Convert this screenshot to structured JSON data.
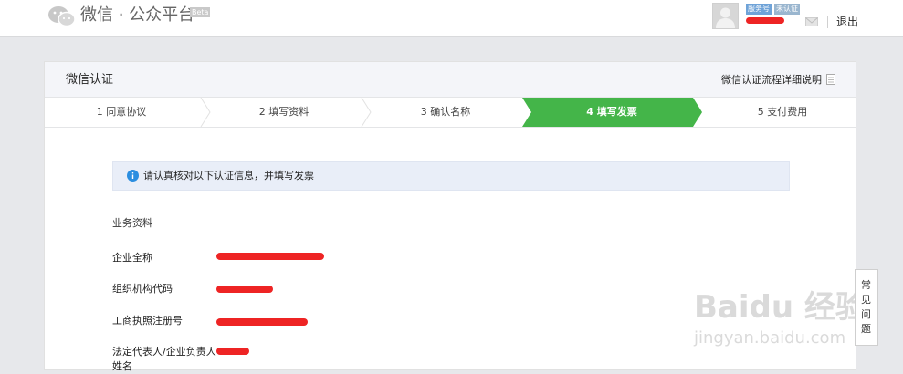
{
  "header": {
    "brand": "微信 · 公众平台",
    "beta": "Beta",
    "tags": [
      "服务号",
      "未认证"
    ],
    "logout": "退出"
  },
  "card": {
    "title": "微信认证",
    "flow_link": "微信认证流程详细说明"
  },
  "steps": [
    {
      "label": "1 同意协议",
      "active": false
    },
    {
      "label": "2 填写资料",
      "active": false
    },
    {
      "label": "3 确认名称",
      "active": false
    },
    {
      "label": "4 填写发票",
      "active": true
    },
    {
      "label": "5 支付费用",
      "active": false
    }
  ],
  "notice": "请认真核对以下认证信息，并填写发票",
  "section": {
    "title": "业务资料",
    "fields": [
      "企业全称",
      "组织机构代码",
      "工商执照注册号",
      "法定代表人/企业负责人姓名"
    ]
  },
  "watermark": {
    "main": "Baidu 经验",
    "sub": "jingyan.baidu.com"
  },
  "faq": "常见问题",
  "colors": {
    "accent": "#44b549",
    "redact": "#ee2424"
  }
}
